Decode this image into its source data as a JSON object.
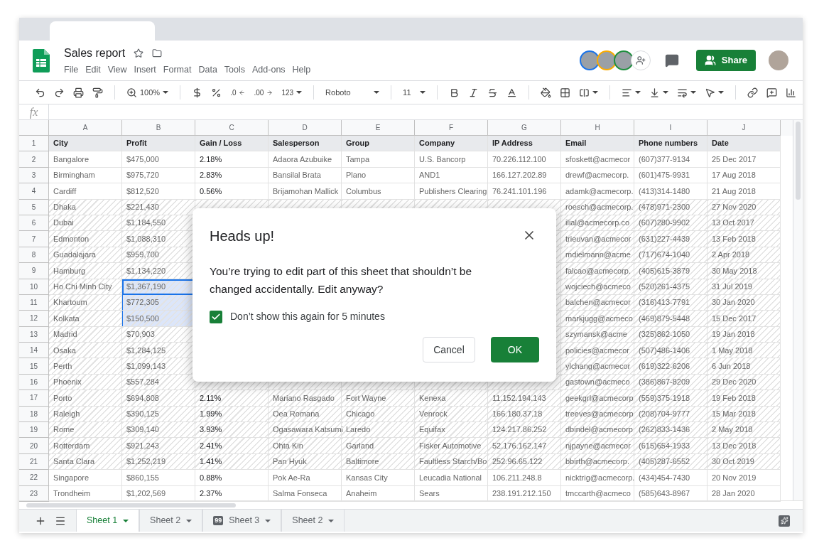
{
  "document": {
    "title": "Sales report"
  },
  "menu": [
    "File",
    "Edit",
    "View",
    "Insert",
    "Format",
    "Data",
    "Tools",
    "Add-ons",
    "Help"
  ],
  "collaborators": [
    {
      "color": "#1a73e8"
    },
    {
      "color": "#f9ab00"
    },
    {
      "color": "#1e8e3e"
    }
  ],
  "share_button": "Share",
  "toolbar": {
    "zoom": "100%",
    "decimal_decrease": ".0",
    "decimal_increase": ".00",
    "number_format": "123",
    "font": "Roboto",
    "font_size": "11"
  },
  "formula_bar": {
    "label": "fx"
  },
  "columns": [
    "A",
    "B",
    "C",
    "D",
    "E",
    "F",
    "G",
    "H",
    "I",
    "J"
  ],
  "rows": [
    {
      "number": "1",
      "kind": "header",
      "protected": false,
      "profit_selected": false,
      "profit_active": false,
      "cells": [
        "City",
        "Profit",
        "Gain / Loss",
        "Salesperson",
        "Group",
        "Company",
        "IP Address",
        "Email",
        "Phone numbers",
        "Date"
      ]
    },
    {
      "number": "2",
      "kind": "data",
      "protected": false,
      "profit_selected": false,
      "profit_active": false,
      "cells": [
        "Bangalore",
        "$475,000",
        "2.18%",
        "Adaora Azubuike",
        "Tampa",
        "U.S. Bancorp",
        "70.226.112.100",
        "sfoskett@acmecor",
        "(607)377-9134",
        "25 Dec 2017"
      ]
    },
    {
      "number": "3",
      "kind": "data",
      "protected": false,
      "profit_selected": false,
      "profit_active": false,
      "cells": [
        "Birmingham",
        "$975,720",
        "2.83%",
        "Bansilal Brata",
        "Plano",
        "AND1",
        "166.127.202.89",
        "drewf@acmecorp.",
        "(601)475-9931",
        "17 Aug 2018"
      ]
    },
    {
      "number": "4",
      "kind": "data",
      "protected": false,
      "profit_selected": false,
      "profit_active": false,
      "cells": [
        "Cardiff",
        "$812,520",
        "0.56%",
        "Brijamohan Mallick",
        "Columbus",
        "Publishers Clearing",
        "76.241.101.196",
        "adamk@acmecorp.",
        "(413)314-1480",
        "21 Aug 2018"
      ]
    },
    {
      "number": "5",
      "kind": "data",
      "protected": true,
      "profit_selected": false,
      "profit_active": false,
      "cells": [
        "Dhaka",
        "$221,430",
        null,
        null,
        null,
        null,
        null,
        "roesch@acmecorp.",
        "(478)971-2300",
        "27 Nov 2020"
      ]
    },
    {
      "number": "6",
      "kind": "data",
      "protected": true,
      "profit_selected": false,
      "profit_active": false,
      "cells": [
        "Dubai",
        "$1,184,550",
        null,
        null,
        null,
        null,
        null,
        "ilial@acmecorp.co",
        "(607)280-9902",
        "13 Oct 2017"
      ]
    },
    {
      "number": "7",
      "kind": "data",
      "protected": true,
      "profit_selected": false,
      "profit_active": false,
      "cells": [
        "Edmonton",
        "$1,088,310",
        null,
        null,
        null,
        null,
        null,
        "trieuvan@acmecor",
        "(631)227-4439",
        "13 Feb 2018"
      ]
    },
    {
      "number": "8",
      "kind": "data",
      "protected": true,
      "profit_selected": false,
      "profit_active": false,
      "cells": [
        "Guadalajara",
        "$959,700",
        null,
        null,
        null,
        null,
        null,
        "mdielmann@acme",
        "(717)674-1040",
        "2 Apr 2018"
      ]
    },
    {
      "number": "9",
      "kind": "data",
      "protected": true,
      "profit_selected": false,
      "profit_active": false,
      "cells": [
        "Hamburg",
        "$1,134,220",
        null,
        null,
        null,
        null,
        null,
        "falcao@acmecorp.",
        "(405)615-3879",
        "30 May 2018"
      ]
    },
    {
      "number": "10",
      "kind": "data",
      "protected": true,
      "profit_selected": true,
      "profit_active": true,
      "cells": [
        "Ho Chi Minh City",
        "$1,367,190",
        null,
        null,
        null,
        null,
        null,
        "wojciech@acmeco",
        "(520)261-4375",
        "31 Jul 2019"
      ]
    },
    {
      "number": "11",
      "kind": "data",
      "protected": true,
      "profit_selected": true,
      "profit_active": false,
      "cells": [
        "Khartoum",
        "$772,305",
        null,
        null,
        null,
        null,
        null,
        "balchen@acmecor",
        "(316)413-7791",
        "30 Jan 2020"
      ]
    },
    {
      "number": "12",
      "kind": "data",
      "protected": true,
      "profit_selected": true,
      "profit_active": false,
      "cells": [
        "Kolkata",
        "$150,500",
        null,
        null,
        null,
        null,
        null,
        "markjugg@acmeco",
        "(469)879-5448",
        "15 Dec 2017"
      ]
    },
    {
      "number": "13",
      "kind": "data",
      "protected": true,
      "profit_selected": false,
      "profit_active": false,
      "cells": [
        "Madrid",
        "$70,903",
        null,
        null,
        null,
        null,
        null,
        "szymansk@acme",
        "(325)862-1050",
        "19 Jan 2018"
      ]
    },
    {
      "number": "14",
      "kind": "data",
      "protected": true,
      "profit_selected": false,
      "profit_active": false,
      "cells": [
        "Osaka",
        "$1,284,125",
        null,
        null,
        null,
        null,
        null,
        "policies@acmecor",
        "(507)486-1406",
        "1 May 2018"
      ]
    },
    {
      "number": "15",
      "kind": "data",
      "protected": true,
      "profit_selected": false,
      "profit_active": false,
      "cells": [
        "Perth",
        "$1,099,143",
        null,
        null,
        null,
        null,
        null,
        "ylchang@acmecor",
        "(619)322-6206",
        "6 Jun 2018"
      ]
    },
    {
      "number": "16",
      "kind": "data",
      "protected": true,
      "profit_selected": false,
      "profit_active": false,
      "cells": [
        "Phoenix",
        "$557,284",
        null,
        null,
        null,
        null,
        null,
        "gastown@acmeco",
        "(386)867-8209",
        "29 Dec 2020"
      ]
    },
    {
      "number": "17",
      "kind": "data",
      "protected": true,
      "profit_selected": false,
      "profit_active": false,
      "cells": [
        "Porto",
        "$694,808",
        "2.11%",
        "Mariano Rasgado",
        "Fort Wayne",
        "Kenexa",
        "11.152.194.143",
        "geekgrl@acmecorp",
        "(559)375-1918",
        "19 Feb 2018"
      ]
    },
    {
      "number": "18",
      "kind": "data",
      "protected": true,
      "profit_selected": false,
      "profit_active": false,
      "cells": [
        "Raleigh",
        "$390,125",
        "1.99%",
        "Oea Romana",
        "Chicago",
        "Venrock",
        "166.180.37.18",
        "treeves@acmecorp",
        "(208)704-9777",
        "15 Mar 2018"
      ]
    },
    {
      "number": "19",
      "kind": "data",
      "protected": true,
      "profit_selected": false,
      "profit_active": false,
      "cells": [
        "Rome",
        "$309,140",
        "3.93%",
        "Ogasawara Katsumi",
        "Laredo",
        "Equifax",
        "124.217.86.252",
        "dbindel@acmecorp",
        "(262)833-1436",
        "2 May 2018"
      ]
    },
    {
      "number": "20",
      "kind": "data",
      "protected": true,
      "profit_selected": false,
      "profit_active": false,
      "cells": [
        "Rotterdam",
        "$921,243",
        "2.41%",
        "Ohta Kin",
        "Garland",
        "Fisker Automotive",
        "52.176.162.147",
        "njpayne@acmecor",
        "(615)654-1933",
        "13 Dec 2018"
      ]
    },
    {
      "number": "21",
      "kind": "data",
      "protected": true,
      "profit_selected": false,
      "profit_active": false,
      "cells": [
        "Santa Clara",
        "$1,252,219",
        "1.41%",
        "Pan Hyuk",
        "Baltimore",
        "Faultless Starch/Bo",
        "252.96.65.122",
        "bbirth@acmecorp.",
        "(405)287-6552",
        "30 Oct 2019"
      ]
    },
    {
      "number": "22",
      "kind": "data",
      "protected": false,
      "profit_selected": false,
      "profit_active": false,
      "cells": [
        "Singapore",
        "$860,155",
        "0.88%",
        "Pok Ae-Ra",
        "Kansas City",
        "Leucadia National",
        "106.211.248.8",
        "nicktrig@acmecorp.",
        "(434)454-7430",
        "20 Nov 2019"
      ]
    },
    {
      "number": "23",
      "kind": "data",
      "protected": false,
      "profit_selected": false,
      "profit_active": false,
      "cells": [
        "Trondheim",
        "$1,202,569",
        "2.37%",
        "Salma Fonseca",
        "Anaheim",
        "Sears",
        "238.191.212.150",
        "tmccarth@acmeco",
        "(585)643-8967",
        "28 Jan 2020"
      ]
    }
  ],
  "sheet_tabs": [
    {
      "label": "Sheet 1",
      "selected": true
    },
    {
      "label": "Sheet 2",
      "selected": false
    },
    {
      "label": "Sheet 3",
      "selected": false,
      "badge": "99"
    },
    {
      "label": "Sheet 2",
      "selected": false
    }
  ],
  "dialog": {
    "title": "Heads up!",
    "message": "You’re trying to edit part of this sheet that shouldn’t be changed accidentally. Edit anyway?",
    "checkbox": {
      "label": "Don’t show this again for 5 minutes",
      "checked": true
    },
    "buttons": [
      {
        "label": "Cancel",
        "kind": "secondary"
      },
      {
        "label": "OK",
        "kind": "primary"
      }
    ]
  }
}
